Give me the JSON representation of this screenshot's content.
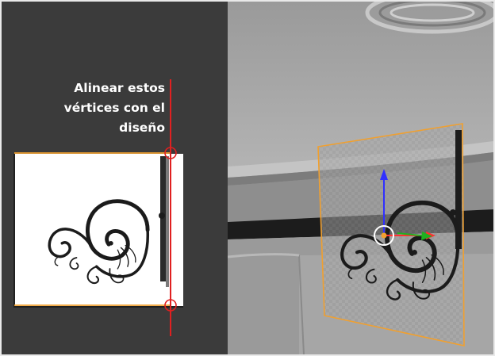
{
  "annotation": {
    "lines": [
      "Alinear estos",
      "vértices con el",
      "diseño"
    ]
  },
  "colors": {
    "guide_line": "#e02020",
    "selection_edge": "#f0a030",
    "left_panel_bg": "#3b3b3b",
    "z_axis": "#3030ff",
    "x_axis": "#ff3030",
    "y_axis": "#20b020"
  },
  "icons": [
    "scroll-ornament",
    "vertex-circle",
    "transform-gizmo",
    "pivot-point"
  ]
}
